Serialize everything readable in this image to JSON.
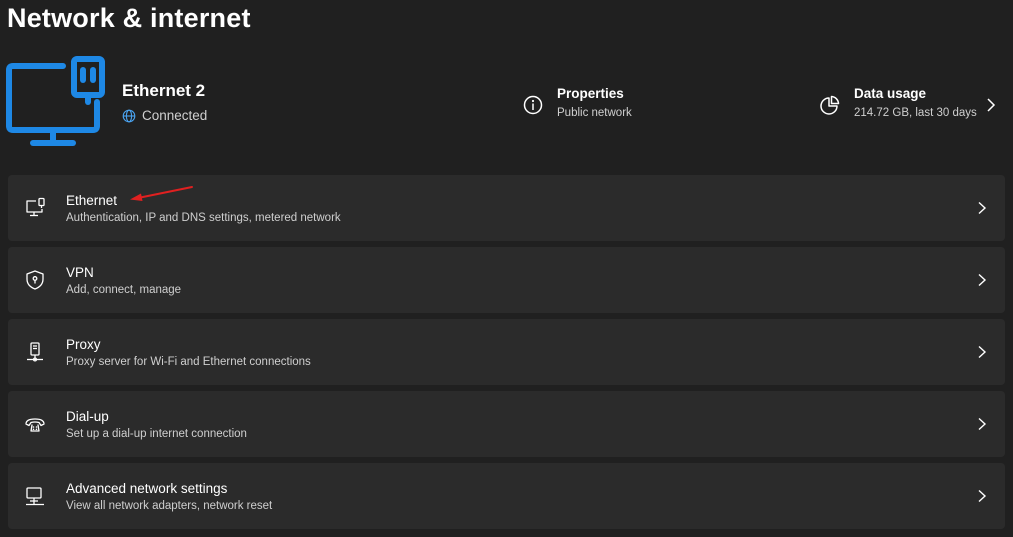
{
  "page": {
    "title": "Network & internet"
  },
  "connection": {
    "name": "Ethernet 2",
    "status": "Connected",
    "icon": "monitor-ethernet-icon",
    "accent_color": "#1e88e5"
  },
  "summary": {
    "properties": {
      "title": "Properties",
      "subtitle": "Public network",
      "icon": "info-icon"
    },
    "data_usage": {
      "title": "Data usage",
      "subtitle": "214.72 GB, last 30 days",
      "icon": "pie-chart-icon"
    }
  },
  "items": [
    {
      "title": "Ethernet",
      "subtitle": "Authentication, IP and DNS settings, metered network",
      "icon": "ethernet-icon"
    },
    {
      "title": "VPN",
      "subtitle": "Add, connect, manage",
      "icon": "vpn-shield-icon"
    },
    {
      "title": "Proxy",
      "subtitle": "Proxy server for Wi-Fi and Ethernet connections",
      "icon": "proxy-icon"
    },
    {
      "title": "Dial-up",
      "subtitle": "Set up a dial-up internet connection",
      "icon": "dial-up-icon"
    },
    {
      "title": "Advanced network settings",
      "subtitle": "View all network adapters, network reset",
      "icon": "advanced-network-icon"
    }
  ],
  "annotation": {
    "color": "#e02020",
    "target": "Ethernet"
  }
}
